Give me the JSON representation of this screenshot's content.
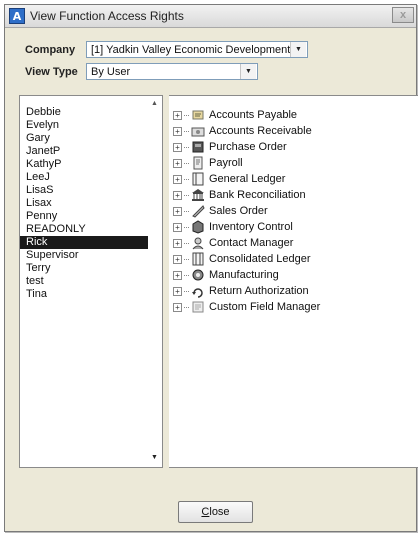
{
  "window": {
    "title": "View Function Access Rights",
    "app_icon_letter": "A",
    "close_glyph": "x"
  },
  "form": {
    "company_label": "Company",
    "company_value": "[1]   Yadkin Valley Economic Development",
    "view_type_label": "View Type",
    "view_type_value": "By User"
  },
  "users": {
    "items": [
      "Debbie",
      "Evelyn",
      "Gary",
      "JanetP",
      "KathyP",
      "LeeJ",
      "LisaS",
      "Lisax",
      "Penny",
      "READONLY",
      "Rick",
      "Supervisor",
      "Terry",
      "test",
      "Tina"
    ],
    "selected": "Rick"
  },
  "rights": {
    "items": [
      {
        "label": "Accounts Payable",
        "icon": "accounts-payable-icon"
      },
      {
        "label": "Accounts Receivable",
        "icon": "accounts-receivable-icon"
      },
      {
        "label": "Purchase Order",
        "icon": "purchase-order-icon"
      },
      {
        "label": "Payroll",
        "icon": "payroll-icon"
      },
      {
        "label": "General Ledger",
        "icon": "general-ledger-icon"
      },
      {
        "label": "Bank Reconciliation",
        "icon": "bank-icon"
      },
      {
        "label": "Sales Order",
        "icon": "sales-order-icon"
      },
      {
        "label": "Inventory Control",
        "icon": "inventory-icon"
      },
      {
        "label": "Contact Manager",
        "icon": "contact-icon"
      },
      {
        "label": "Consolidated Ledger",
        "icon": "consolidated-ledger-icon"
      },
      {
        "label": "Manufacturing",
        "icon": "manufacturing-icon"
      },
      {
        "label": "Return Authorization",
        "icon": "return-icon"
      },
      {
        "label": "Custom Field Manager",
        "icon": "custom-field-icon"
      }
    ]
  },
  "buttons": {
    "close_label_first": "C",
    "close_label_rest": "lose"
  }
}
